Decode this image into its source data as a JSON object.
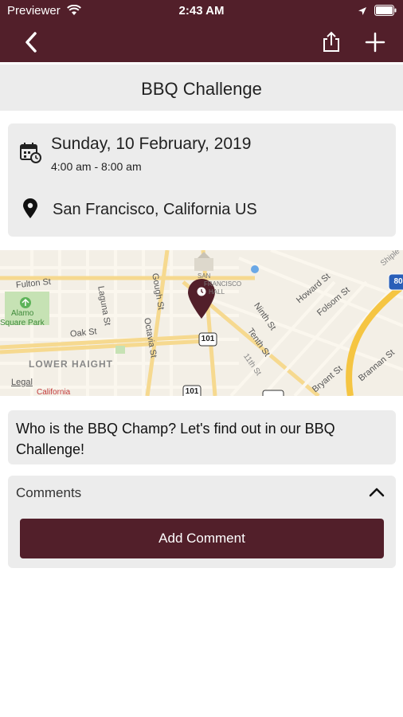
{
  "status_bar": {
    "carrier": "Previewer",
    "time": "2:43 AM"
  },
  "nav": {
    "icons": [
      "back-chevron-icon",
      "share-icon",
      "plus-icon"
    ]
  },
  "event": {
    "title": "BBQ Challenge",
    "date": "Sunday, 10 February, 2019",
    "time_range": "4:00 am - 8:00 am",
    "location": "San Francisco, California US",
    "description": "Who is the BBQ Champ?  Let's find out in our BBQ Challenge!"
  },
  "map": {
    "labels": {
      "fulton": "Fulton St",
      "laguna": "Laguna St",
      "gough": "Gough St",
      "octavia": "Octavia St",
      "oak": "Oak St",
      "alamo": "Alamo",
      "square_park": "Square Park",
      "lower_haight": "LOWER HAIGHT",
      "legal": "Legal",
      "california": "California",
      "ninth": "Ninth St",
      "tenth": "Tenth St",
      "eleventh": "11th St",
      "howard": "Howard St",
      "folsom": "Folsom St",
      "bryant": "Bryant St",
      "brannan": "Brannan St",
      "shipley": "Shiple",
      "hwy101a": "101",
      "hwy101b": "101",
      "hwy80": "80",
      "san": "SAN",
      "francisco": "FRANCISCO",
      "hall": "HALL"
    }
  },
  "comments": {
    "label": "Comments",
    "add_button": "Add Comment"
  },
  "colors": {
    "brand": "#521f2a",
    "card_bg": "#ececec"
  }
}
